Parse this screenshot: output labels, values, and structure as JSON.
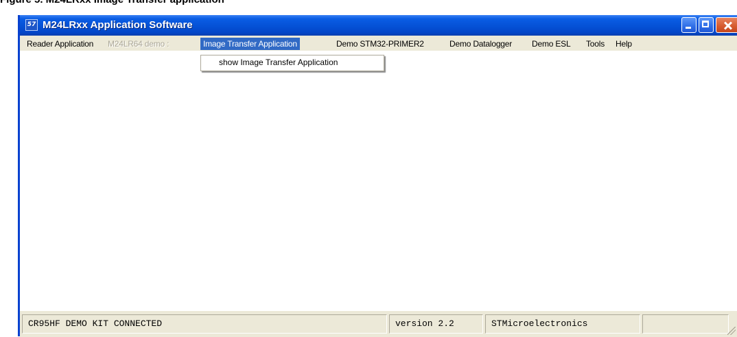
{
  "caption": "Figure 5. M24LRxx Image Transfer application",
  "window": {
    "title": "M24LRxx Application Software",
    "icon_text": "57"
  },
  "menubar": {
    "items": [
      {
        "label": "Reader Application"
      },
      {
        "label": "M24LR64 demo :"
      },
      {
        "label": "Image Transfer Application"
      },
      {
        "label": "Demo STM32-PRIMER2"
      },
      {
        "label": "Demo Datalogger"
      },
      {
        "label": "Demo ESL"
      },
      {
        "label": "Tools"
      },
      {
        "label": "Help"
      }
    ]
  },
  "dropdown": {
    "items": [
      {
        "label": "show  Image Transfer Application"
      }
    ]
  },
  "statusbar": {
    "connection": "CR95HF DEMO KIT CONNECTED",
    "version": "version 2.2",
    "vendor": "STMicroelectronics",
    "extra": ""
  },
  "colors": {
    "titlebar": "#0551d6",
    "menu_highlight": "#316ac5",
    "close_button": "#d55a2e"
  }
}
